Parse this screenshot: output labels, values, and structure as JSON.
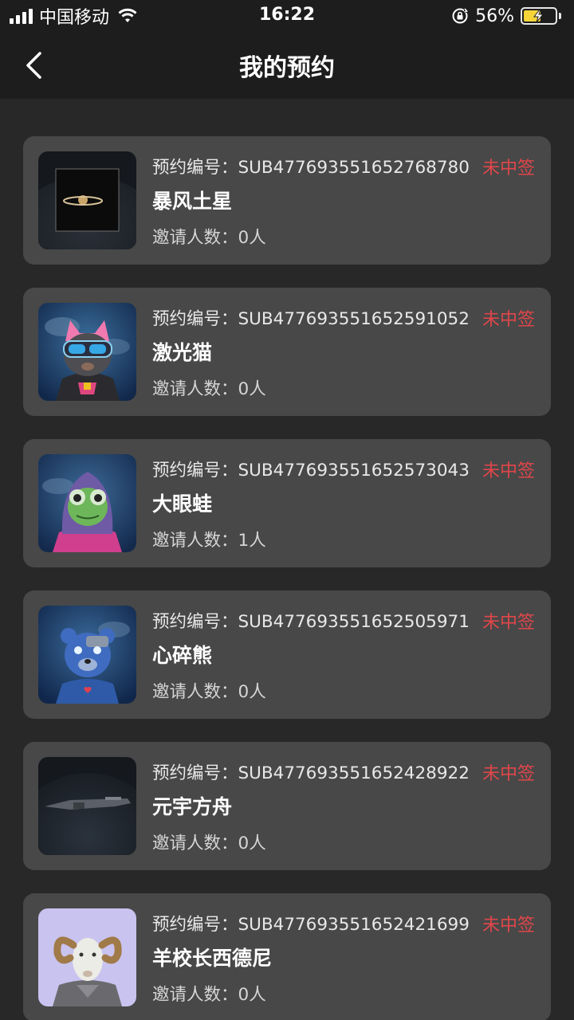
{
  "status_bar": {
    "carrier": "中国移动",
    "time": "16:22",
    "battery": "56%",
    "battery_level": 0.56,
    "icons": [
      "signal-icon",
      "wifi-icon",
      "rotation-lock-icon",
      "battery-charging-icon"
    ]
  },
  "nav": {
    "title": "我的预约",
    "back_icon": "chevron-left-icon"
  },
  "reservations": [
    {
      "label": "预约编号：",
      "id": "SUB477693551652768780",
      "status": "未中签",
      "name": "暴风土星",
      "invite_label": "邀请人数：",
      "invite_count": "0人",
      "image": "saturn-image"
    },
    {
      "label": "预约编号：",
      "id": "SUB477693551652591052",
      "status": "未中签",
      "name": "激光猫",
      "invite_label": "邀请人数：",
      "invite_count": "0人",
      "image": "laser-cat-image"
    },
    {
      "label": "预约编号：",
      "id": "SUB477693551652573043",
      "status": "未中签",
      "name": "大眼蛙",
      "invite_label": "邀请人数：",
      "invite_count": "1人",
      "image": "big-eye-frog-image"
    },
    {
      "label": "预约编号：",
      "id": "SUB477693551652505971",
      "status": "未中签",
      "name": "心碎熊",
      "invite_label": "邀请人数：",
      "invite_count": "0人",
      "image": "heartbroken-bear-image"
    },
    {
      "label": "预约编号：",
      "id": "SUB477693551652428922",
      "status": "未中签",
      "name": "元宇方舟",
      "invite_label": "邀请人数：",
      "invite_count": "0人",
      "image": "metaverse-ark-image"
    },
    {
      "label": "预约编号：",
      "id": "SUB477693551652421699",
      "status": "未中签",
      "name": "羊校长西德尼",
      "invite_label": "邀请人数：",
      "invite_count": "0人",
      "image": "principal-ram-image"
    }
  ],
  "colors": {
    "background": "#282828",
    "header": "#1d1d1d",
    "card": "#484848",
    "status": "#e0464a"
  }
}
